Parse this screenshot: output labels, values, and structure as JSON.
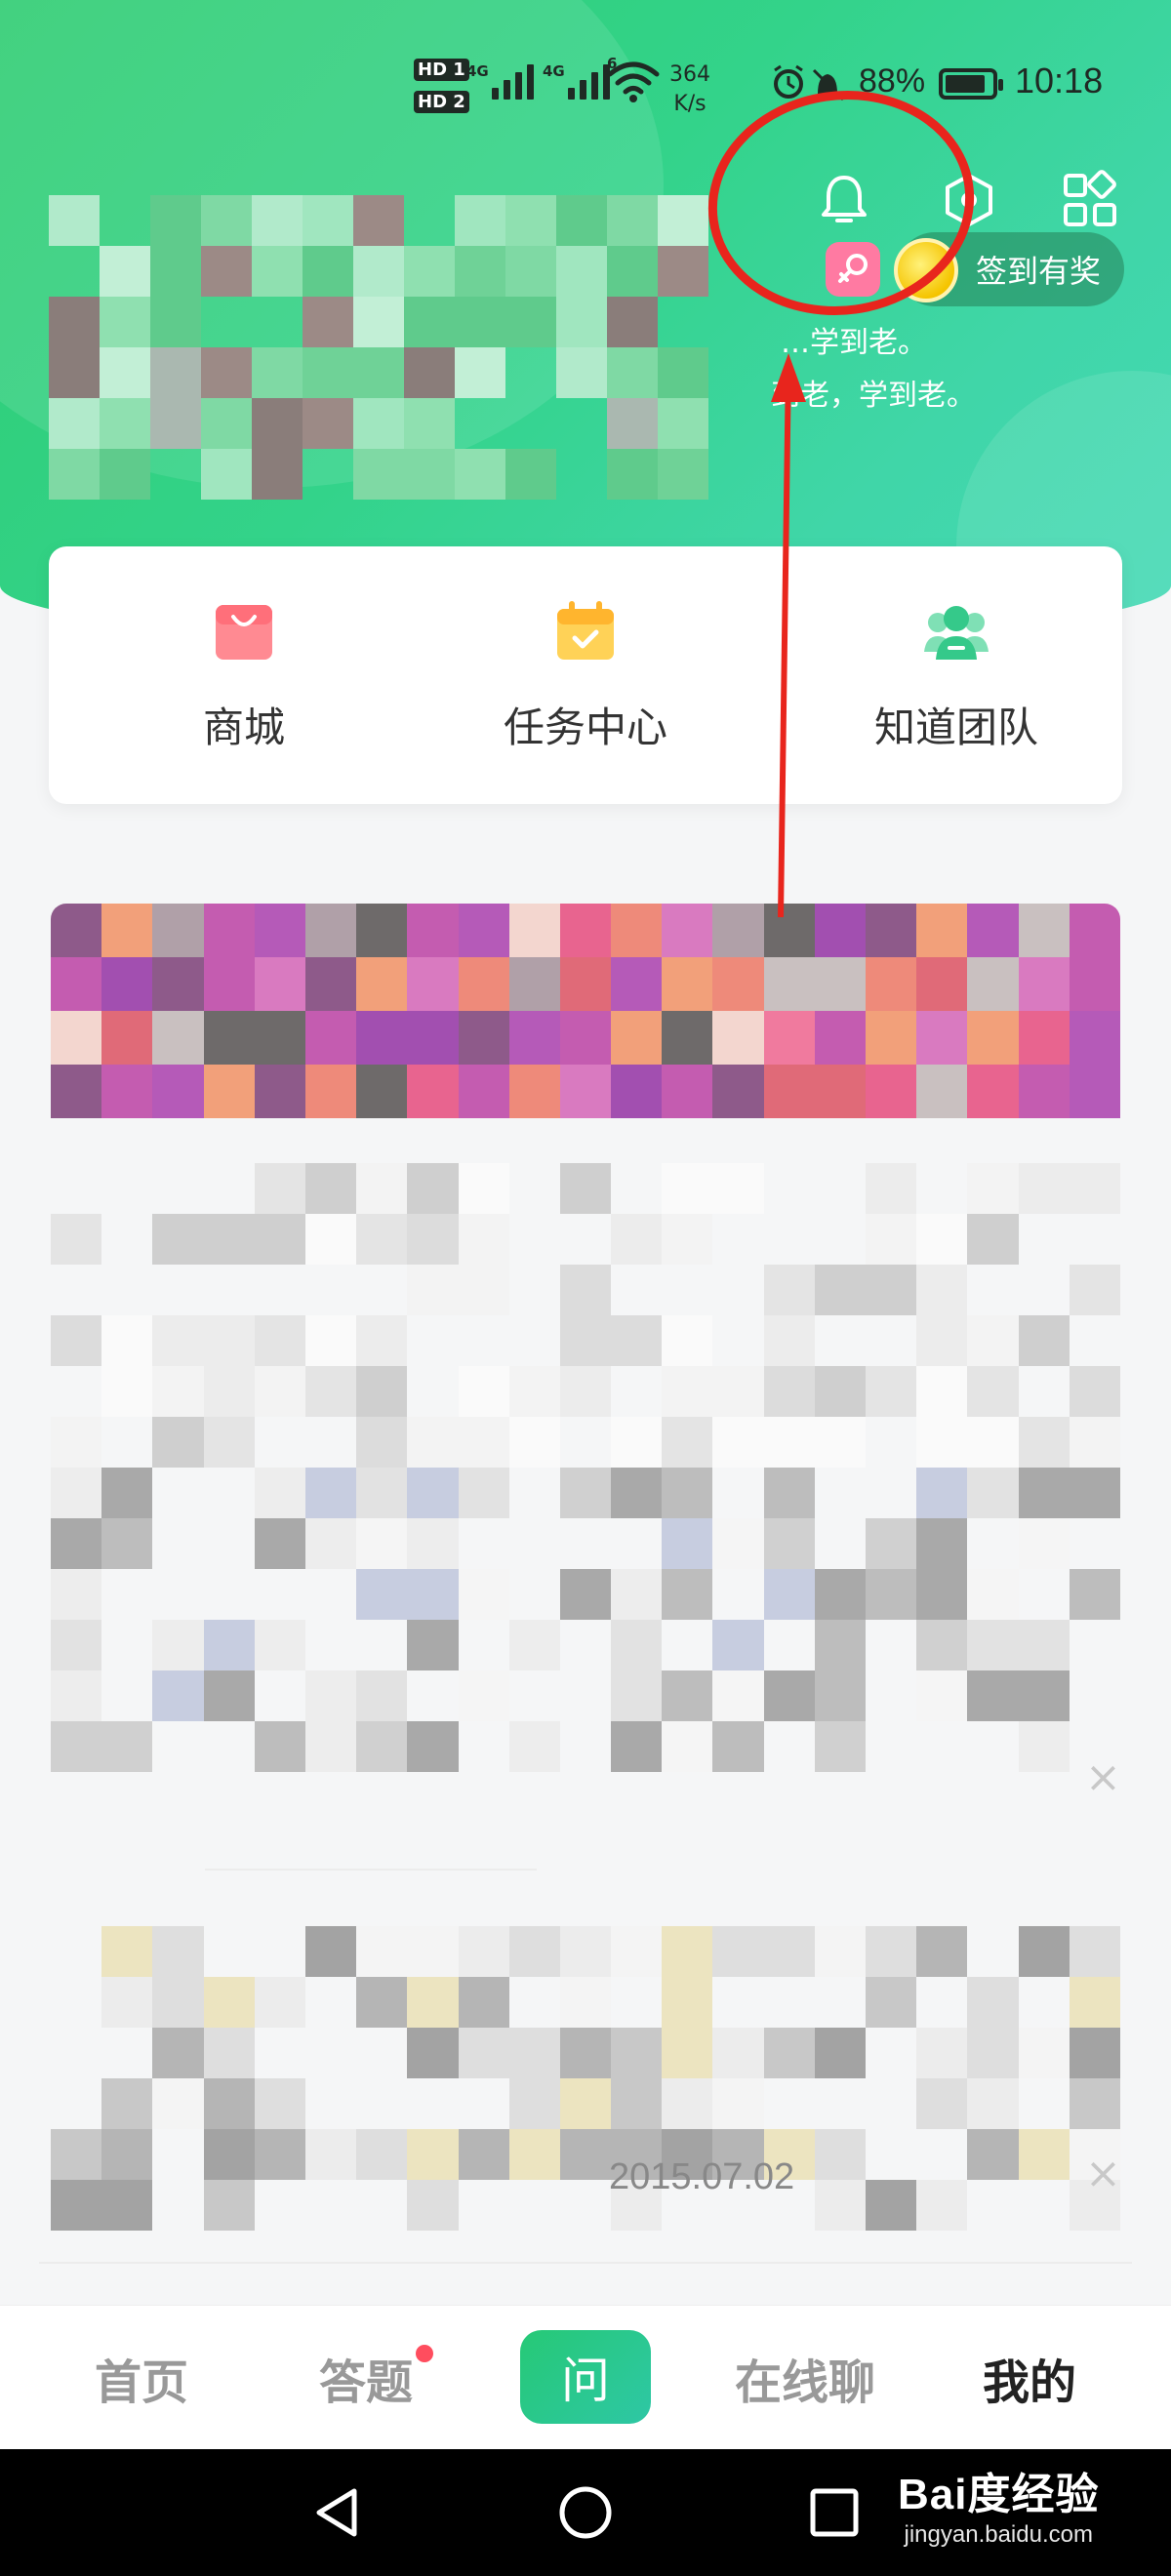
{
  "status_bar": {
    "sim1": "HD 1",
    "sim2": "HD 2",
    "network1": "4G",
    "network2": "4G",
    "wifi_gen": "6",
    "speed_value": "364",
    "speed_unit": "K/s",
    "battery": "88%",
    "battery_level": 0.88,
    "time": "10:18"
  },
  "header": {
    "checkin_label": "签到有奖",
    "slogan_line1": "…学到老。",
    "slogan_line2": "到老，学到老。",
    "icons": [
      "bell-icon",
      "hexagon-settings-icon",
      "apps-grid-icon"
    ]
  },
  "quick_entries": [
    {
      "label": "商城",
      "icon": "shop-bag-icon",
      "color": "#ff6f7a"
    },
    {
      "label": "任务中心",
      "icon": "task-calendar-icon",
      "color": "#ffc233"
    },
    {
      "label": "知道团队",
      "icon": "team-icon",
      "color": "#35c98a"
    }
  ],
  "feed": {
    "date": "2015.07.02",
    "close_symbol": "×"
  },
  "tabbar": {
    "tabs": [
      {
        "label": "首页"
      },
      {
        "label": "答题",
        "badge": true
      },
      {
        "label": "问"
      },
      {
        "label": "在线聊"
      },
      {
        "label": "我的",
        "active": true
      }
    ]
  },
  "watermark": {
    "main": "Bai度经验",
    "sub": "jingyan.baidu.com"
  },
  "colors": {
    "brand_green": "#2ecc71",
    "annotation_red": "#e8251d",
    "badge_red": "#ff4d5e"
  }
}
